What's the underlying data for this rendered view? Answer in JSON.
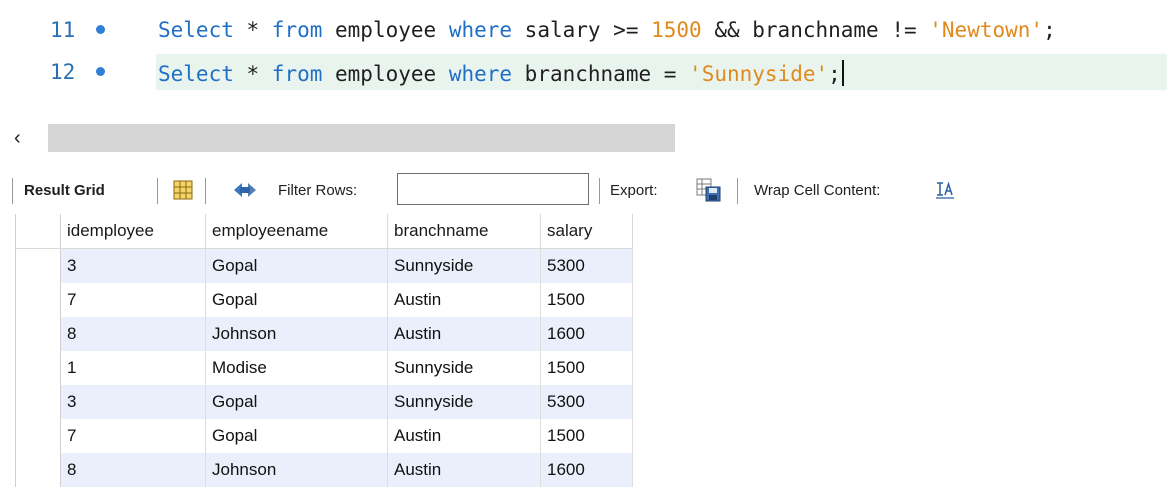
{
  "editor": {
    "lines": [
      {
        "number": "11",
        "tokens": [
          {
            "t": "Select",
            "c": "kw"
          },
          {
            "t": " * ",
            "c": "op"
          },
          {
            "t": "from",
            "c": "kw"
          },
          {
            "t": " employee ",
            "c": "op"
          },
          {
            "t": "where",
            "c": "kw"
          },
          {
            "t": " salary >= ",
            "c": "op"
          },
          {
            "t": "1500",
            "c": "num"
          },
          {
            "t": " && branchname != ",
            "c": "op"
          },
          {
            "t": "'Newtown'",
            "c": "str"
          },
          {
            "t": ";",
            "c": "op"
          }
        ]
      },
      {
        "number": "12",
        "tokens": [
          {
            "t": "Select",
            "c": "kw"
          },
          {
            "t": " * ",
            "c": "op"
          },
          {
            "t": "from",
            "c": "kw"
          },
          {
            "t": " employee ",
            "c": "op"
          },
          {
            "t": "where",
            "c": "kw"
          },
          {
            "t": " branchname = ",
            "c": "op"
          },
          {
            "t": "'Sunnyside'",
            "c": "str"
          },
          {
            "t": ";",
            "c": "op"
          }
        ]
      }
    ]
  },
  "scrollbar": {
    "left_arrow": "‹"
  },
  "toolbar": {
    "result_grid": "Result Grid",
    "filter_rows": "Filter Rows:",
    "filter_value": "",
    "export": "Export:",
    "wrap_cell": "Wrap Cell Content:"
  },
  "grid": {
    "columns": [
      "idemployee",
      "employeename",
      "branchname",
      "salary"
    ],
    "rows": [
      [
        "3",
        "Gopal",
        "Sunnyside",
        "5300"
      ],
      [
        "7",
        "Gopal",
        "Austin",
        "1500"
      ],
      [
        "8",
        "Johnson",
        "Austin",
        "1600"
      ],
      [
        "1",
        "Modise",
        "Sunnyside",
        "1500"
      ],
      [
        "3",
        "Gopal",
        "Sunnyside",
        "5300"
      ],
      [
        "7",
        "Gopal",
        "Austin",
        "1500"
      ],
      [
        "8",
        "Johnson",
        "Austin",
        "1600"
      ]
    ]
  },
  "colors": {
    "keyword": "#1f6fc6",
    "literal": "#e08a1e",
    "row_stripe": "#e9f0fb",
    "current_line": "#eaf4ef"
  },
  "icons": [
    "bullet-icon",
    "form-editor-icon",
    "refresh-icon",
    "export-icon",
    "wrap-cell-icon",
    "scroll-left-icon"
  ]
}
